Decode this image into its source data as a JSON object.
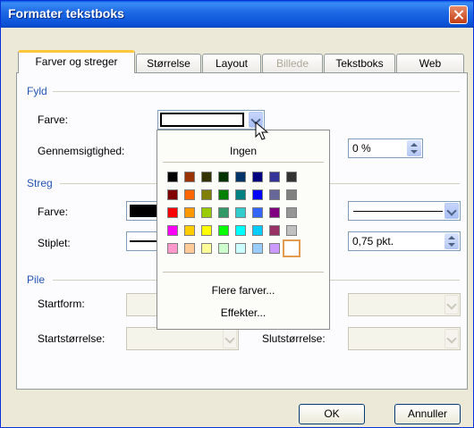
{
  "window": {
    "title": "Formater tekstboks"
  },
  "tabs": [
    {
      "label": "Farver og streger",
      "state": "active"
    },
    {
      "label": "Størrelse",
      "state": "normal"
    },
    {
      "label": "Layout",
      "state": "normal"
    },
    {
      "label": "Billede",
      "state": "disabled"
    },
    {
      "label": "Tekstboks",
      "state": "normal"
    },
    {
      "label": "Web",
      "state": "normal"
    }
  ],
  "fill": {
    "group": "Fyld",
    "color_label": "Farve:",
    "transparency_label": "Gennemsigtighed:",
    "transparency_value": "0 %"
  },
  "line": {
    "group": "Streg",
    "color_label": "Farve:",
    "dash_label": "Stiplet:",
    "weight_value": "0,75 pkt."
  },
  "arrows": {
    "group": "Pile",
    "begin_style_label": "Startform:",
    "begin_size_label": "Startstørrelse:",
    "end_size_label": "Slutstørrelse:"
  },
  "color_popup": {
    "none_label": "Ingen",
    "more_colors_label": "Flere farver...",
    "effects_label": "Effekter...",
    "swatch_rows": [
      [
        "#000000",
        "#993300",
        "#333300",
        "#003300",
        "#003366",
        "#000080",
        "#333399",
        "#333333"
      ],
      [
        "#800000",
        "#ff6600",
        "#808000",
        "#008000",
        "#008080",
        "#0000ff",
        "#666699",
        "#808080"
      ],
      [
        "#ff0000",
        "#ff9900",
        "#99cc00",
        "#339966",
        "#33cccc",
        "#3366ff",
        "#800080",
        "#969696"
      ],
      [
        "#ff00ff",
        "#ffcc00",
        "#ffff00",
        "#00ff00",
        "#00ffff",
        "#00ccff",
        "#993366",
        "#c0c0c0"
      ],
      [
        "#ff99cc",
        "#ffcc99",
        "#ffff99",
        "#ccffcc",
        "#ccffff",
        "#99ccff",
        "#cc99ff",
        "#ffffff"
      ]
    ],
    "selected_color": "#ffffff"
  },
  "buttons": {
    "ok": "OK",
    "cancel": "Annuller"
  },
  "colors": {
    "title_bar": "#0a5ee4",
    "group_label": "#2553b5",
    "tab_highlight": "#ffc83c"
  }
}
